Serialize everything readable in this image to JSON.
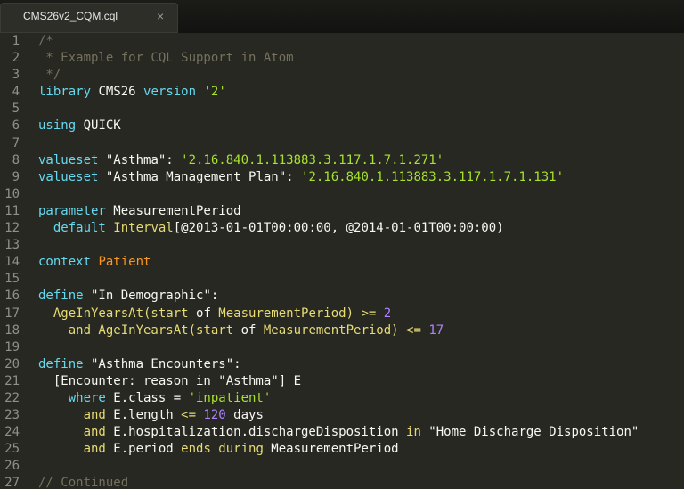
{
  "tab": {
    "title": "CMS26v2_CQM.cql",
    "close": "×"
  },
  "colors": {
    "background": "#272822",
    "comment": "#75715e",
    "keyword": "#66d9ef",
    "string": "#e6db74",
    "number": "#ae81ff",
    "function": "#a6e22e",
    "type": "#fd971f"
  },
  "lines": [
    [
      {
        "t": "/*",
        "c": "comment"
      }
    ],
    [
      {
        "t": " * Example for CQL Support in Atom",
        "c": "comment"
      }
    ],
    [
      {
        "t": " */",
        "c": "comment"
      }
    ],
    [
      {
        "t": "library",
        "c": "kw"
      },
      {
        "t": " CMS26 ",
        "c": "id"
      },
      {
        "t": "version",
        "c": "kw"
      },
      {
        "t": " ",
        "c": "id"
      },
      {
        "t": "'2'",
        "c": "green"
      }
    ],
    [],
    [
      {
        "t": "using",
        "c": "kw"
      },
      {
        "t": " QUICK",
        "c": "id"
      }
    ],
    [],
    [
      {
        "t": "valueset",
        "c": "kw"
      },
      {
        "t": " \"Asthma\": ",
        "c": "id"
      },
      {
        "t": "'2.16.840.1.113883.3.117.1.7.1.271'",
        "c": "green"
      }
    ],
    [
      {
        "t": "valueset",
        "c": "kw"
      },
      {
        "t": " \"Asthma Management Plan\": ",
        "c": "id"
      },
      {
        "t": "'2.16.840.1.113883.3.117.1.7.1.131'",
        "c": "green"
      }
    ],
    [],
    [
      {
        "t": "parameter",
        "c": "kw"
      },
      {
        "t": " MeasurementPeriod",
        "c": "id"
      }
    ],
    [
      {
        "t": "  default",
        "c": "kw"
      },
      {
        "t": " ",
        "c": "id"
      },
      {
        "t": "Interval",
        "c": "str"
      },
      {
        "t": "[@2013-01-01T00:00:00, @2014-01-01T00:00:00)",
        "c": "id"
      }
    ],
    [],
    [
      {
        "t": "context",
        "c": "kw"
      },
      {
        "t": " ",
        "c": "id"
      },
      {
        "t": "Patient",
        "c": "orange"
      }
    ],
    [],
    [
      {
        "t": "define",
        "c": "kw"
      },
      {
        "t": " \"In Demographic\":",
        "c": "id"
      }
    ],
    [
      {
        "t": "  AgeInYearsAt(start ",
        "c": "str"
      },
      {
        "t": "of",
        "c": "id"
      },
      {
        "t": " MeasurementPeriod) >= ",
        "c": "str"
      },
      {
        "t": "2",
        "c": "num"
      }
    ],
    [
      {
        "t": "    and AgeInYearsAt(start ",
        "c": "str"
      },
      {
        "t": "of",
        "c": "id"
      },
      {
        "t": " MeasurementPeriod) <= ",
        "c": "str"
      },
      {
        "t": "17",
        "c": "num"
      }
    ],
    [],
    [
      {
        "t": "define",
        "c": "kw"
      },
      {
        "t": " \"Asthma Encounters\":",
        "c": "id"
      }
    ],
    [
      {
        "t": "  [Encounter: reason in \"Asthma\"] E",
        "c": "id"
      }
    ],
    [
      {
        "t": "    where",
        "c": "kw"
      },
      {
        "t": " E.class = ",
        "c": "id"
      },
      {
        "t": "'inpatient'",
        "c": "green"
      }
    ],
    [
      {
        "t": "      and",
        "c": "str"
      },
      {
        "t": " E.length ",
        "c": "id"
      },
      {
        "t": "<=",
        "c": "str"
      },
      {
        "t": " ",
        "c": "id"
      },
      {
        "t": "120",
        "c": "num"
      },
      {
        "t": " days",
        "c": "id"
      }
    ],
    [
      {
        "t": "      and",
        "c": "str"
      },
      {
        "t": " E.hospitalization.dischargeDisposition ",
        "c": "id"
      },
      {
        "t": "in",
        "c": "str"
      },
      {
        "t": " \"Home Discharge Disposition\"",
        "c": "id"
      }
    ],
    [
      {
        "t": "      and",
        "c": "str"
      },
      {
        "t": " E.period ",
        "c": "id"
      },
      {
        "t": "ends during",
        "c": "str"
      },
      {
        "t": " MeasurementPeriod",
        "c": "id"
      }
    ],
    [],
    [
      {
        "t": "// Continued",
        "c": "comment"
      }
    ]
  ]
}
